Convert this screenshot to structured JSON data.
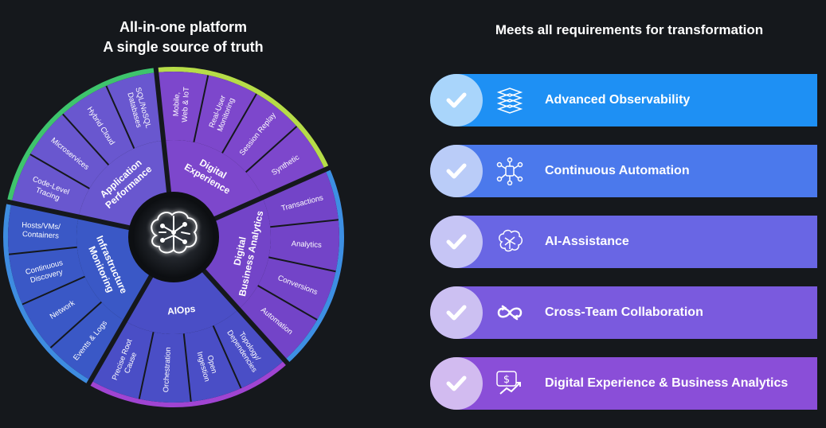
{
  "left_title": [
    "All-in-one platform",
    "A single source of truth"
  ],
  "right_title": "Meets all requirements for transformation",
  "wheel": {
    "center_icon": "brain-circuit-icon",
    "segments": [
      {
        "name": "Application Performance",
        "lines": [
          "Application",
          "Performance"
        ],
        "color": "#6957cf",
        "band": "#3ec46d",
        "items": [
          {
            "lines": [
              "Code-Level",
              "Tracing"
            ]
          },
          {
            "lines": [
              "Microservices"
            ]
          },
          {
            "lines": [
              "Hybrid Cloud"
            ]
          },
          {
            "lines": [
              "SQL/NoSQL",
              "Databases"
            ]
          }
        ]
      },
      {
        "name": "Digital Experience",
        "lines": [
          "Digital",
          "Experience"
        ],
        "color": "#7d47cc",
        "band": "#b6dc48",
        "items": [
          {
            "lines": [
              "Mobile,",
              "Web & IoT"
            ]
          },
          {
            "lines": [
              "Real-User",
              "Monitoring"
            ]
          },
          {
            "lines": [
              "Session Replay"
            ]
          },
          {
            "lines": [
              "Synthetic"
            ]
          }
        ]
      },
      {
        "name": "Digital Business Analytics",
        "lines": [
          "Digital",
          "Business Analytics"
        ],
        "color": "#7344c8",
        "band": "#3d8fe3",
        "items": [
          {
            "lines": [
              "Transactions"
            ]
          },
          {
            "lines": [
              "Analytics"
            ]
          },
          {
            "lines": [
              "Conversions"
            ]
          },
          {
            "lines": [
              "Automation"
            ]
          }
        ]
      },
      {
        "name": "AIOps",
        "lines": [
          "AIOps"
        ],
        "color": "#4a4ec6",
        "band": "#a044d2",
        "items": [
          {
            "lines": [
              "Topology/",
              "Dependencies"
            ]
          },
          {
            "lines": [
              "Open",
              "Ingestion"
            ]
          },
          {
            "lines": [
              "Orchestration"
            ]
          },
          {
            "lines": [
              "Precise Root",
              "Cause"
            ]
          }
        ]
      },
      {
        "name": "Infrastructure Monitoring",
        "lines": [
          "Infrastructure",
          "Monitoring"
        ],
        "color": "#3a58c6",
        "band": "#3e8ce0",
        "items": [
          {
            "lines": [
              "Events & Logs"
            ]
          },
          {
            "lines": [
              "Network"
            ]
          },
          {
            "lines": [
              "Continuous",
              "Discovery"
            ]
          },
          {
            "lines": [
              "Hosts/VMs/",
              "Containers"
            ]
          }
        ]
      }
    ]
  },
  "requirements": [
    {
      "label": "Advanced Observability",
      "icon": "layers-network-icon",
      "color": "#1e90f4"
    },
    {
      "label": "Continuous Automation",
      "icon": "automation-network-icon",
      "color": "#4b79ec"
    },
    {
      "label": "AI-Assistance",
      "icon": "ai-brain-icon",
      "color": "#6966e4"
    },
    {
      "label": "Cross-Team Collaboration",
      "icon": "infinity-arrows-icon",
      "color": "#7a5ade"
    },
    {
      "label": "Digital Experience & Business Analytics",
      "icon": "dollar-chart-icon",
      "color": "#8a4ed8"
    }
  ],
  "check_icon": "checkmark-icon"
}
